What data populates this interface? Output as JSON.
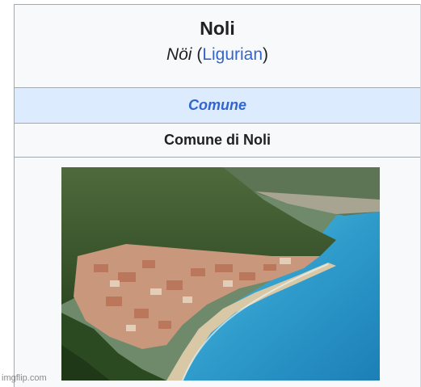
{
  "infobox": {
    "title": "Noli",
    "native_name": "Nöi",
    "native_open": "(",
    "native_language": "Ligurian",
    "native_close": ")",
    "type": "Comune",
    "official_name": "Comune di Noli"
  },
  "image": {
    "description_icon": "aerial-photo-of-noli"
  },
  "watermark": "imgflip.com",
  "colors": {
    "link": "#3366cc",
    "type_row_bg": "#ddebfe",
    "border": "#a2a9b1",
    "sea": "#2e9fc9"
  }
}
